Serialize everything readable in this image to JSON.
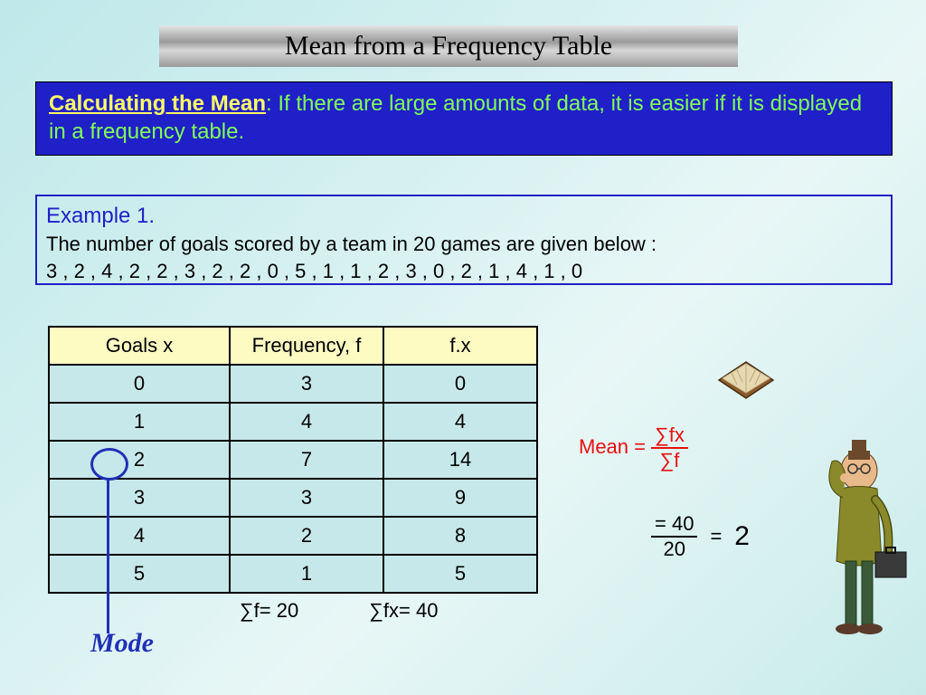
{
  "title": "Mean from a Frequency Table",
  "intro": {
    "lead": "Calculating the Mean",
    "rest": ": If there are large amounts of data, it is easier if it is displayed in a frequency table."
  },
  "example": {
    "heading": "Example 1.",
    "desc": "The number of goals scored by a team in 20 games are given below :",
    "data": "3 , 2 , 4 , 2 , 2 , 3 , 2 , 2 , 0 , 5 , 1 , 1 , 2 , 3 , 0 , 2 , 1 , 4 , 1 , 0"
  },
  "table": {
    "headers": {
      "x": "Goals  x",
      "f": "Frequency, f",
      "fx": "f.x"
    },
    "rows": [
      {
        "x": "0",
        "f": "3",
        "fx": "0"
      },
      {
        "x": "1",
        "f": "4",
        "fx": "4"
      },
      {
        "x": "2",
        "f": "7",
        "fx": "14"
      },
      {
        "x": "3",
        "f": "3",
        "fx": "9"
      },
      {
        "x": "4",
        "f": "2",
        "fx": "8"
      },
      {
        "x": "5",
        "f": "1",
        "fx": "5"
      }
    ],
    "sum_f": "∑f= 20",
    "sum_fx": "∑fx= 40"
  },
  "mode_label": "Mode",
  "mean": {
    "label": "Mean =",
    "num": "∑fx",
    "den": "∑f",
    "eq1_num": "= 40",
    "eq1_den": "20",
    "eq2_label": "=",
    "eq2_val": "2"
  }
}
